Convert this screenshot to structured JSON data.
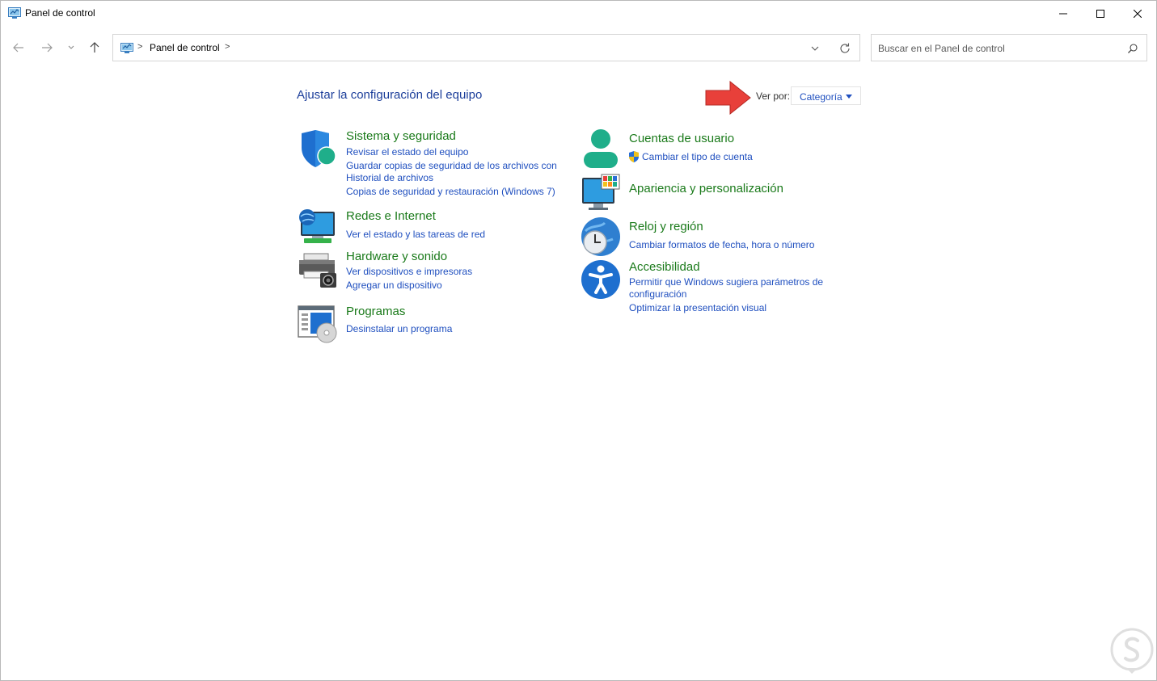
{
  "window": {
    "title": "Panel de control"
  },
  "address": {
    "crumb": "Panel de control",
    "separator": ">"
  },
  "search": {
    "placeholder": "Buscar en el Panel de control"
  },
  "main": {
    "heading": "Ajustar la configuración del equipo",
    "view_by_label": "Ver por:",
    "view_by_value": "Categoría"
  },
  "categories": {
    "system": {
      "title": "Sistema y seguridad",
      "links": [
        "Revisar el estado del equipo",
        "Guardar copias de seguridad de los archivos con",
        "Historial de archivos",
        "Copias de seguridad y restauración (Windows 7)"
      ]
    },
    "network": {
      "title": "Redes e Internet",
      "links": [
        "Ver el estado y las tareas de red"
      ]
    },
    "hardware": {
      "title": "Hardware y sonido",
      "links": [
        "Ver dispositivos e impresoras",
        "Agregar un dispositivo"
      ]
    },
    "programs": {
      "title": "Programas",
      "links": [
        "Desinstalar un programa"
      ]
    },
    "users": {
      "title": "Cuentas de usuario",
      "links": [
        "Cambiar el tipo de cuenta"
      ]
    },
    "appearance": {
      "title": "Apariencia y personalización",
      "links": []
    },
    "clock": {
      "title": "Reloj y región",
      "links": [
        "Cambiar formatos de fecha, hora o número"
      ]
    },
    "access": {
      "title": "Accesibilidad",
      "links": [
        "Permitir que Windows sugiera parámetros de",
        "configuración",
        "Optimizar la presentación visual"
      ]
    }
  },
  "colors": {
    "heading_blue": "#1c3e9a",
    "link_blue": "#1f4fbf",
    "category_green": "#1a7a1a",
    "annotation_red": "#e8403a"
  }
}
